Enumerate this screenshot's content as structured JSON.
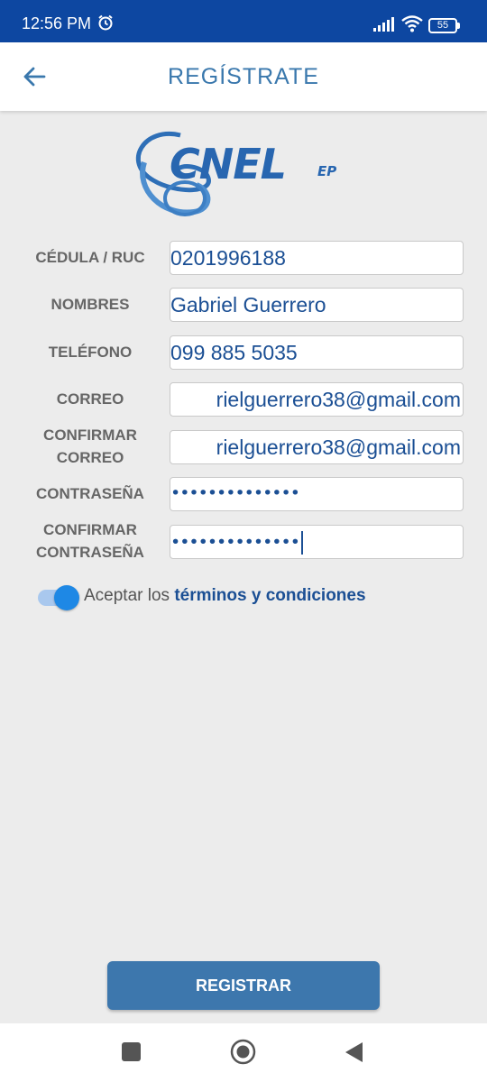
{
  "status_bar": {
    "time": "12:56 PM",
    "battery": "55"
  },
  "app_bar": {
    "title": "REGÍSTRATE",
    "back_icon": "arrow-left-icon"
  },
  "logo": {
    "main": "CNEL",
    "suffix": "EP"
  },
  "form": {
    "cedula": {
      "label": "CÉDULA / RUC",
      "value": "0201996188"
    },
    "nombres": {
      "label": "NOMBRES",
      "value": "Gabriel Guerrero"
    },
    "telefono": {
      "label": "TELÉFONO",
      "value": "099 885 5035"
    },
    "correo": {
      "label": "CORREO",
      "value": "rielguerrero38@gmail.com"
    },
    "confirmar_correo": {
      "label_line1": "CONFIRMAR",
      "label_line2": "CORREO",
      "value": "rielguerrero38@gmail.com"
    },
    "contrasena": {
      "label": "CONTRASEÑA",
      "value": "••••••••••••••"
    },
    "confirmar_contrasena": {
      "label_line1": "CONFIRMAR",
      "label_line2": "CONTRASEÑA",
      "value": "••••••••••••••"
    }
  },
  "terms": {
    "prefix": "Aceptar los ",
    "link": "términos y condiciones",
    "accepted": true
  },
  "register_button": "REGISTRAR",
  "colors": {
    "status_bar": "#0d47a1",
    "accent": "#3d77ad",
    "link": "#1b4f94",
    "background": "#ececec"
  }
}
